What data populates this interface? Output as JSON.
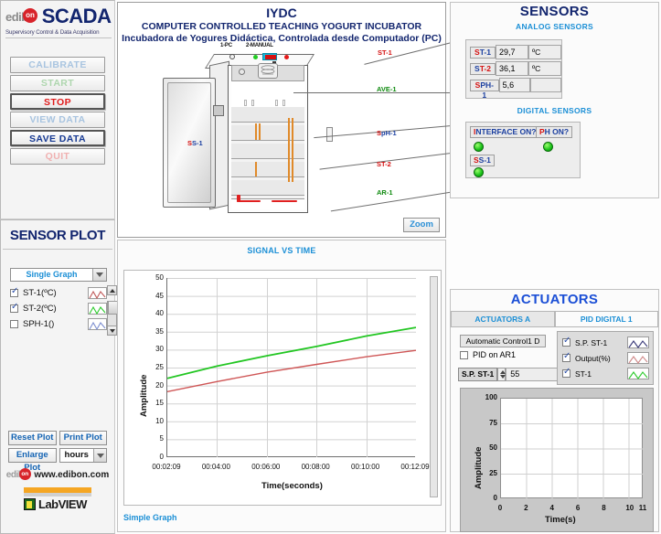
{
  "brand": {
    "logo_word": "edib",
    "logo_dot": "on",
    "title": "SCADA",
    "subtitle": "Supervisory Control & Data Acquisition"
  },
  "main_buttons": [
    {
      "label": "CALIBRATE",
      "state": "disabled"
    },
    {
      "label": "START",
      "state": "disabled"
    },
    {
      "label": "STOP",
      "state": "active"
    },
    {
      "label": "VIEW DATA",
      "state": "disabled"
    },
    {
      "label": "SAVE DATA",
      "state": "active"
    },
    {
      "label": "QUIT",
      "state": "disabled"
    }
  ],
  "diagram": {
    "title_code": "IYDC",
    "title_en": "COMPUTER CONTROLLED TEACHING YOGURT INCUBATOR",
    "title_es": "Incubadora de Yogures Didáctica, Controlada desde Computador (PC)",
    "mode_pc": "1-PC",
    "mode_manual": "2-MANUAL",
    "door_label": "SS-1",
    "callouts": [
      {
        "prefix": "S",
        "rest": "T-1",
        "prefix_color": "#d51010",
        "rest_color": "#d51010"
      },
      {
        "prefix": "A",
        "rest": "VE-1",
        "prefix_color": "#0f8a0f",
        "rest_color": "#0f8a0f"
      },
      {
        "prefix": "S",
        "rest": "pH-1",
        "prefix_color": "#d51010",
        "rest_color": "#1b3fa0"
      },
      {
        "prefix": "S",
        "rest": "T-2",
        "prefix_color": "#d51010",
        "rest_color": "#d51010"
      },
      {
        "prefix": "A",
        "rest": "R-1",
        "prefix_color": "#0f8a0f",
        "rest_color": "#0f8a0f"
      }
    ],
    "zoom_button": "Zoom"
  },
  "sensors": {
    "title": "SENSORS",
    "analog_heading": "ANALOG SENSORS",
    "analog_rows": [
      {
        "tag_a": "S",
        "tag_b": "T-1",
        "tag_a_color": "#d51010",
        "tag_b_color": "#1b3fa0",
        "value": "29,7",
        "unit": "ºC"
      },
      {
        "tag_a": "S",
        "tag_b": "T-2",
        "tag_a_color": "#1b3fa0",
        "tag_b_color": "#d51010",
        "value": "36,1",
        "unit": "ºC"
      },
      {
        "tag_a": "S",
        "tag_b": "PH-1",
        "tag_a_color": "#d51010",
        "tag_b_color": "#1b3fa0",
        "value": "5,6",
        "unit": ""
      }
    ],
    "digital_heading": "DIGITAL SENSORS",
    "digital_items": [
      {
        "tag_a": "I",
        "tag_b": "NTERFACE ON?",
        "tag_a_color": "#d51010",
        "tag_b_color": "#1b3fa0",
        "led": "on"
      },
      {
        "tag_a": "P",
        "tag_b": "H ON?",
        "tag_a_color": "#d51010",
        "tag_b_color": "#1b3fa0",
        "led": "on"
      },
      {
        "tag_a": "S",
        "tag_b": "S-1",
        "tag_a_color": "#d51010",
        "tag_b_color": "#1b3fa0",
        "led": "on"
      }
    ],
    "led_color": "#18c018"
  },
  "actuators": {
    "title": "ACTUATORS",
    "tabs": [
      {
        "label": "ACTUATORS A",
        "active": false
      },
      {
        "label": "PID DIGITAL 1",
        "active": true
      }
    ],
    "control_mode": "Automatic Control1 D",
    "pid_checkbox_label": "PID on AR1",
    "pid_checkbox_checked": false,
    "sp_tag": "S.P. ST-1",
    "sp_value": "55",
    "legend": [
      {
        "label": "S.P. ST-1",
        "checked": true,
        "color": "#3b3b7a"
      },
      {
        "label": "Output(%)",
        "checked": true,
        "color": "#d08a8a"
      },
      {
        "label": "ST-1",
        "checked": true,
        "color": "#2ecb2e"
      }
    ]
  },
  "sensor_plot": {
    "title": "SENSOR PLOT",
    "graph_mode": "Single Graph",
    "series": [
      {
        "label": "ST-1(ºC)",
        "checked": true,
        "color": "#c05a5a"
      },
      {
        "label": "ST-2(ºC)",
        "checked": true,
        "color": "#2ecb2e"
      },
      {
        "label": "SPH-1()",
        "checked": false,
        "color": "#7d8fd0"
      }
    ],
    "buttons": {
      "reset": "Reset Plot",
      "print": "Print Plot",
      "enlarge": "Enlarge Plot",
      "time_unit": "hours"
    },
    "footer_web_logo": "edib",
    "footer_web_dot": "on",
    "footer_web": "www.edibon.com",
    "labview": "LabVIEW",
    "signal_heading": "SIGNAL VS TIME",
    "graph_name": "Simple Graph"
  },
  "chart_data": [
    {
      "type": "line",
      "title": "SIGNAL VS TIME",
      "xlabel": "Time(seconds)",
      "ylabel": "Amplitude",
      "ylim": [
        0,
        50
      ],
      "ytick_labels": [
        "0",
        "5",
        "10",
        "15",
        "20",
        "25",
        "30",
        "35",
        "40",
        "45",
        "50"
      ],
      "ytick_values": [
        0,
        5,
        10,
        15,
        20,
        25,
        30,
        35,
        40,
        45,
        50
      ],
      "xtick_labels": [
        "00:02:09",
        "00:04:00",
        "00:06:00",
        "00:08:00",
        "00:10:00",
        "00:12:09"
      ],
      "grid": true,
      "legend_position": "external-left",
      "series": [
        {
          "name": "ST-2(ºC)",
          "color": "#22c622",
          "x": [
            0,
            0.2,
            0.4,
            0.6,
            0.8,
            1.0
          ],
          "values": [
            22.0,
            25.4,
            28.3,
            30.9,
            33.8,
            36.2
          ]
        },
        {
          "name": "ST-1(ºC)",
          "color": "#cf5656",
          "x": [
            0,
            0.2,
            0.4,
            0.6,
            0.8,
            1.0
          ],
          "values": [
            18.3,
            21.1,
            23.7,
            25.9,
            28.0,
            29.8
          ]
        }
      ]
    },
    {
      "type": "line",
      "title": "PID DIGITAL 1",
      "xlabel": "Time(s)",
      "ylabel": "Amplitude",
      "ylim": [
        0,
        100
      ],
      "ytick_labels": [
        "0",
        "25",
        "50",
        "75",
        "100"
      ],
      "ytick_values": [
        0,
        25,
        50,
        75,
        100
      ],
      "xtick_labels": [
        "0",
        "2",
        "4",
        "6",
        "8",
        "10",
        "11"
      ],
      "xlim": [
        0,
        11
      ],
      "grid": true,
      "series": []
    }
  ]
}
